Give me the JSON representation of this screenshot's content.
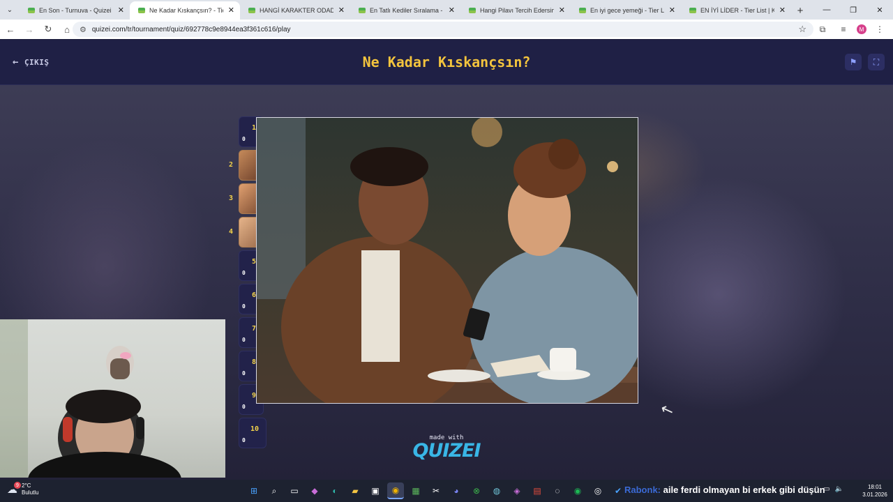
{
  "browser": {
    "tabs": [
      {
        "label": "En Son - Turnuva - Quizei",
        "active": false
      },
      {
        "label": "Ne Kadar Kıskançsın? - Tier List",
        "active": true
      },
      {
        "label": "HANGİ KARAKTER ODADAN SA",
        "active": false
      },
      {
        "label": "En Tatlı Kediler Sıralama - Tier l",
        "active": false
      },
      {
        "label": "Hangi Pilavı Tercih Edersin? - Ti",
        "active": false
      },
      {
        "label": "En iyi gece yemeği - Tier List | K",
        "active": false
      },
      {
        "label": "EN İYİ LİDER - Tier List | Kör Sır",
        "active": false
      }
    ],
    "url": "quizei.com/tr/tournament/quiz/692778c9e8944ea3f361c616/play",
    "profile_initial": "M"
  },
  "header": {
    "exit_label": "ÇIKIŞ",
    "title": "Ne Kadar Kıskançsın?"
  },
  "slots": [
    {
      "number": "1",
      "score": "0",
      "has_image": false
    },
    {
      "number": "2",
      "score": "",
      "has_image": true
    },
    {
      "number": "3",
      "score": "",
      "has_image": true
    },
    {
      "number": "4",
      "score": "",
      "has_image": true
    },
    {
      "number": "5",
      "score": "0",
      "has_image": false
    },
    {
      "number": "6",
      "score": "0",
      "has_image": false
    },
    {
      "number": "7",
      "score": "0",
      "has_image": false
    },
    {
      "number": "8",
      "score": "0",
      "has_image": false
    },
    {
      "number": "9",
      "score": "0",
      "has_image": false
    },
    {
      "number": "10",
      "score": "0",
      "has_image": false
    }
  ],
  "footer": {
    "made_with": "made with",
    "brand": "QUIZEI"
  },
  "taskbar": {
    "weather_temp": "2°C",
    "weather_desc": "Bulutlu",
    "weather_badge": "9",
    "chat_user": "Rabonk:",
    "chat_message": "aile ferdi olmayan bi erkek gibi düşün",
    "time": "18:01",
    "date": "3.01.2026"
  },
  "colors": {
    "title": "#f3c43d",
    "page_bg": "#1b1c3a",
    "slot_number": "#f2d24b",
    "brand": "#39b6e6",
    "chat_user": "#3b6ad6"
  }
}
